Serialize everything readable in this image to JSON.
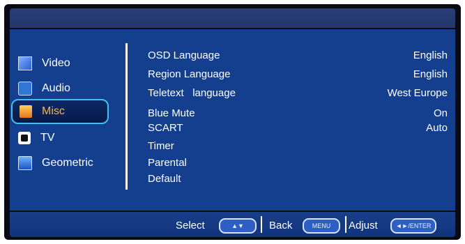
{
  "menu": {
    "items": [
      {
        "label": "Video",
        "icon": "video-icon"
      },
      {
        "label": "Audio",
        "icon": "audio-icon"
      },
      {
        "label": "Misc",
        "icon": "misc-icon",
        "selected": true
      },
      {
        "label": "TV",
        "icon": "tv-icon"
      },
      {
        "label": "Geometric",
        "icon": "geometric-icon"
      }
    ]
  },
  "settings": [
    {
      "label": "OSD Language",
      "value": "English"
    },
    {
      "label": "Region Language",
      "value": "English"
    },
    {
      "label": "Teletext   language",
      "value": "West Europe"
    },
    {
      "label": "Blue Mute",
      "value": "On"
    },
    {
      "label": "SCART",
      "value": "Auto"
    },
    {
      "label": "Timer",
      "value": ""
    },
    {
      "label": "Parental",
      "value": ""
    },
    {
      "label": "Default",
      "value": ""
    }
  ],
  "footer": {
    "select_label": "Select",
    "select_key": "▲▼",
    "back_label": "Back",
    "back_key": "MENU",
    "adjust_label": "Adjust",
    "adjust_key": "◄►/ENTER"
  },
  "colors": {
    "panel": "#143f8f",
    "highlight_border": "#3fc0ef",
    "selected_text": "#f6b93a"
  }
}
